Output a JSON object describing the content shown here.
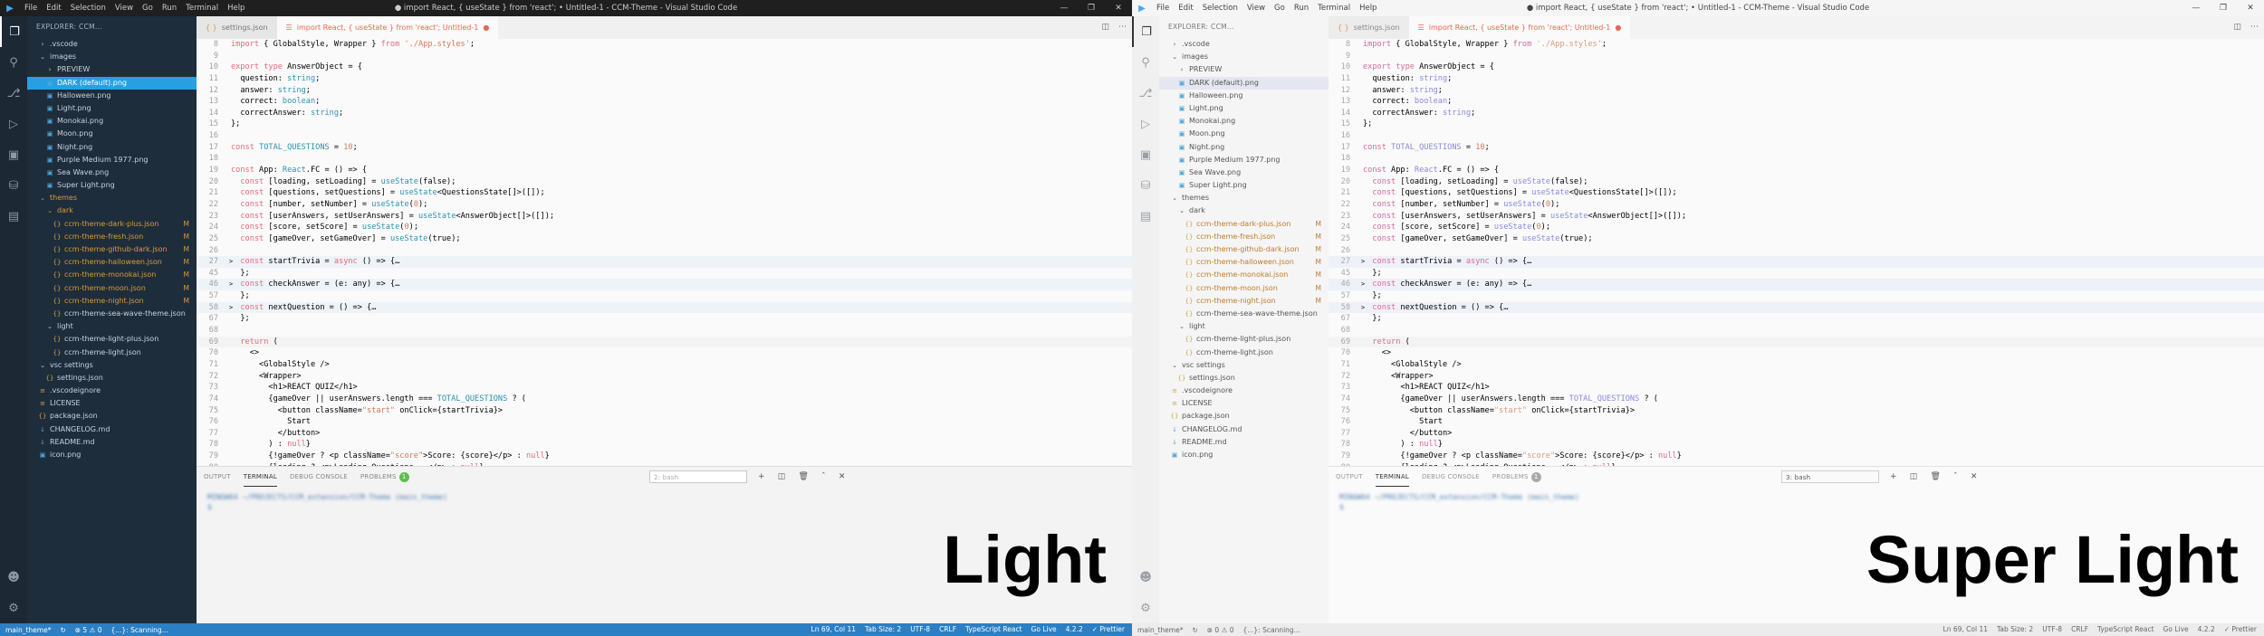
{
  "windows": [
    {
      "theme_label": "Light",
      "title": "● import React, { useState } from 'react'; • Untitled-1 - CCM-Theme - Visual Studio Code",
      "menus": [
        "File",
        "Edit",
        "Selection",
        "View",
        "Go",
        "Run",
        "Terminal",
        "Help"
      ],
      "sidebar_title": "EXPLORER: CCM...",
      "tabs": [
        {
          "label": "settings.json",
          "active": false
        },
        {
          "label": "import React, { useState } from 'react'; Untitled-1",
          "active": true
        }
      ]
    },
    {
      "theme_label": "Super Light",
      "title": "● import React, { useState } from 'react'; • Untitled-1 - CCM-Theme - Visual Studio Code",
      "menus": [
        "File",
        "Edit",
        "Selection",
        "View",
        "Go",
        "Run",
        "Terminal",
        "Help"
      ],
      "sidebar_title": "EXPLORER: CCM...",
      "tabs": [
        {
          "label": "settings.json",
          "active": false
        },
        {
          "label": "import React, { useState } from 'react'; Untitled-1",
          "active": true
        }
      ]
    }
  ],
  "tree_left": [
    {
      "label": ".vscode",
      "depth": 1,
      "kind": "folder"
    },
    {
      "label": "images",
      "depth": 1,
      "kind": "folder-open"
    },
    {
      "label": "PREVIEW",
      "depth": 2,
      "kind": "folder"
    },
    {
      "label": "DARK (default).png",
      "depth": 2,
      "kind": "png",
      "sel": true
    },
    {
      "label": "Halloween.png",
      "depth": 2,
      "kind": "png"
    },
    {
      "label": "Light.png",
      "depth": 2,
      "kind": "png"
    },
    {
      "label": "Monokai.png",
      "depth": 2,
      "kind": "png"
    },
    {
      "label": "Moon.png",
      "depth": 2,
      "kind": "png"
    },
    {
      "label": "Night.png",
      "depth": 2,
      "kind": "png"
    },
    {
      "label": "Purple Medium 1977.png",
      "depth": 2,
      "kind": "png"
    },
    {
      "label": "Sea Wave.png",
      "depth": 2,
      "kind": "png"
    },
    {
      "label": "Super Light.png",
      "depth": 2,
      "kind": "png"
    },
    {
      "label": "themes",
      "depth": 1,
      "kind": "folder-open",
      "mod": true
    },
    {
      "label": "dark",
      "depth": 2,
      "kind": "folder-open",
      "mod": true
    },
    {
      "label": "ccm-theme-dark-plus.json",
      "depth": 3,
      "kind": "json",
      "mod": true,
      "badge": "M"
    },
    {
      "label": "ccm-theme-fresh.json",
      "depth": 3,
      "kind": "json",
      "mod": true,
      "badge": "M"
    },
    {
      "label": "ccm-theme-github-dark.json",
      "depth": 3,
      "kind": "json",
      "mod": true,
      "badge": "M"
    },
    {
      "label": "ccm-theme-halloween.json",
      "depth": 3,
      "kind": "json",
      "mod": true,
      "badge": "M"
    },
    {
      "label": "ccm-theme-monokai.json",
      "depth": 3,
      "kind": "json",
      "mod": true,
      "badge": "M"
    },
    {
      "label": "ccm-theme-moon.json",
      "depth": 3,
      "kind": "json",
      "mod": true,
      "badge": "M"
    },
    {
      "label": "ccm-theme-night.json",
      "depth": 3,
      "kind": "json",
      "mod": true,
      "badge": "M"
    },
    {
      "label": "ccm-theme-sea-wave-theme.json",
      "depth": 3,
      "kind": "json"
    },
    {
      "label": "light",
      "depth": 2,
      "kind": "folder-open"
    },
    {
      "label": "ccm-theme-light-plus.json",
      "depth": 3,
      "kind": "json"
    },
    {
      "label": "ccm-theme-light.json",
      "depth": 3,
      "kind": "json"
    },
    {
      "label": "vsc settings",
      "depth": 1,
      "kind": "folder-open"
    },
    {
      "label": "settings.json",
      "depth": 2,
      "kind": "json"
    },
    {
      "label": ".vscodeignore",
      "depth": 1,
      "kind": "file"
    },
    {
      "label": "LICENSE",
      "depth": 1,
      "kind": "file"
    },
    {
      "label": "package.json",
      "depth": 1,
      "kind": "json"
    },
    {
      "label": "CHANGELOG.md",
      "depth": 1,
      "kind": "md"
    },
    {
      "label": "README.md",
      "depth": 1,
      "kind": "md"
    },
    {
      "label": "icon.png",
      "depth": 1,
      "kind": "png"
    }
  ],
  "tree_right": [
    {
      "label": ".vscode",
      "depth": 1,
      "kind": "folder"
    },
    {
      "label": "images",
      "depth": 1,
      "kind": "folder-open"
    },
    {
      "label": "PREVIEW",
      "depth": 2,
      "kind": "folder"
    },
    {
      "label": "DARK (default).png",
      "depth": 2,
      "kind": "png",
      "sel": true
    },
    {
      "label": "Halloween.png",
      "depth": 2,
      "kind": "png"
    },
    {
      "label": "Light.png",
      "depth": 2,
      "kind": "png"
    },
    {
      "label": "Monokai.png",
      "depth": 2,
      "kind": "png"
    },
    {
      "label": "Moon.png",
      "depth": 2,
      "kind": "png"
    },
    {
      "label": "Night.png",
      "depth": 2,
      "kind": "png"
    },
    {
      "label": "Purple Medium 1977.png",
      "depth": 2,
      "kind": "png"
    },
    {
      "label": "Sea Wave.png",
      "depth": 2,
      "kind": "png"
    },
    {
      "label": "Super Light.png",
      "depth": 2,
      "kind": "png"
    },
    {
      "label": "themes",
      "depth": 1,
      "kind": "folder-open"
    },
    {
      "label": "dark",
      "depth": 2,
      "kind": "folder-open"
    },
    {
      "label": "ccm-theme-dark-plus.json",
      "depth": 3,
      "kind": "json",
      "mod": true,
      "badge": "M"
    },
    {
      "label": "ccm-theme-fresh.json",
      "depth": 3,
      "kind": "json",
      "mod": true,
      "badge": "M"
    },
    {
      "label": "ccm-theme-github-dark.json",
      "depth": 3,
      "kind": "json",
      "mod": true,
      "badge": "M"
    },
    {
      "label": "ccm-theme-halloween.json",
      "depth": 3,
      "kind": "json",
      "mod": true,
      "badge": "M"
    },
    {
      "label": "ccm-theme-monokai.json",
      "depth": 3,
      "kind": "json",
      "mod": true,
      "badge": "M"
    },
    {
      "label": "ccm-theme-moon.json",
      "depth": 3,
      "kind": "json",
      "mod": true,
      "badge": "M"
    },
    {
      "label": "ccm-theme-night.json",
      "depth": 3,
      "kind": "json",
      "mod": true,
      "badge": "M"
    },
    {
      "label": "ccm-theme-sea-wave-theme.json",
      "depth": 3,
      "kind": "json"
    },
    {
      "label": "light",
      "depth": 2,
      "kind": "folder-open"
    },
    {
      "label": "ccm-theme-light-plus.json",
      "depth": 3,
      "kind": "json"
    },
    {
      "label": "ccm-theme-light.json",
      "depth": 3,
      "kind": "json"
    },
    {
      "label": "vsc settings",
      "depth": 1,
      "kind": "folder-open"
    },
    {
      "label": "settings.json",
      "depth": 2,
      "kind": "json"
    },
    {
      "label": ".vscodeignore",
      "depth": 1,
      "kind": "file"
    },
    {
      "label": "LICENSE",
      "depth": 1,
      "kind": "file"
    },
    {
      "label": "package.json",
      "depth": 1,
      "kind": "json"
    },
    {
      "label": "CHANGELOG.md",
      "depth": 1,
      "kind": "md"
    },
    {
      "label": "README.md",
      "depth": 1,
      "kind": "md"
    },
    {
      "label": "icon.png",
      "depth": 1,
      "kind": "png"
    }
  ],
  "code_lines": [
    {
      "n": "8",
      "fold": "",
      "text": "import { GlobalStyle, Wrapper } from './App.styles';",
      "cls": ""
    },
    {
      "n": "9",
      "fold": "",
      "text": "",
      "cls": ""
    },
    {
      "n": "10",
      "fold": "",
      "text": "export type AnswerObject = {",
      "cls": ""
    },
    {
      "n": "11",
      "fold": "",
      "text": "  question: string;",
      "cls": ""
    },
    {
      "n": "12",
      "fold": "",
      "text": "  answer: string;",
      "cls": ""
    },
    {
      "n": "13",
      "fold": "",
      "text": "  correct: boolean;",
      "cls": ""
    },
    {
      "n": "14",
      "fold": "",
      "text": "  correctAnswer: string;",
      "cls": ""
    },
    {
      "n": "15",
      "fold": "",
      "text": "};",
      "cls": ""
    },
    {
      "n": "16",
      "fold": "",
      "text": "",
      "cls": ""
    },
    {
      "n": "17",
      "fold": "",
      "text": "const TOTAL_QUESTIONS = 10;",
      "cls": ""
    },
    {
      "n": "18",
      "fold": "",
      "text": "",
      "cls": ""
    },
    {
      "n": "19",
      "fold": "",
      "text": "const App: React.FC = () => {",
      "cls": ""
    },
    {
      "n": "20",
      "fold": "",
      "text": "  const [loading, setLoading] = useState(false);",
      "cls": ""
    },
    {
      "n": "21",
      "fold": "",
      "text": "  const [questions, setQuestions] = useState<QuestionsState[]>([]);",
      "cls": ""
    },
    {
      "n": "22",
      "fold": "",
      "text": "  const [number, setNumber] = useState(0);",
      "cls": ""
    },
    {
      "n": "23",
      "fold": "",
      "text": "  const [userAnswers, setUserAnswers] = useState<AnswerObject[]>([]);",
      "cls": ""
    },
    {
      "n": "24",
      "fold": "",
      "text": "  const [score, setScore] = useState(0);",
      "cls": ""
    },
    {
      "n": "25",
      "fold": "",
      "text": "  const [gameOver, setGameOver] = useState(true);",
      "cls": ""
    },
    {
      "n": "26",
      "fold": "",
      "text": "",
      "cls": ""
    },
    {
      "n": "27",
      "fold": ">",
      "text": "  const startTrivia = async () => {…",
      "cls": "hl"
    },
    {
      "n": "45",
      "fold": "",
      "text": "  };",
      "cls": ""
    },
    {
      "n": "46",
      "fold": ">",
      "text": "  const checkAnswer = (e: any) => {…",
      "cls": "hl"
    },
    {
      "n": "57",
      "fold": "",
      "text": "  };",
      "cls": ""
    },
    {
      "n": "58",
      "fold": ">",
      "text": "  const nextQuestion = () => {…",
      "cls": "hl"
    },
    {
      "n": "67",
      "fold": "",
      "text": "  };",
      "cls": ""
    },
    {
      "n": "68",
      "fold": "",
      "text": "",
      "cls": ""
    },
    {
      "n": "69",
      "fold": "",
      "text": "  return (",
      "cls": "cur"
    },
    {
      "n": "70",
      "fold": "",
      "text": "    <>",
      "cls": ""
    },
    {
      "n": "71",
      "fold": "",
      "text": "      <GlobalStyle />",
      "cls": ""
    },
    {
      "n": "72",
      "fold": "",
      "text": "      <Wrapper>",
      "cls": ""
    },
    {
      "n": "73",
      "fold": "",
      "text": "        <h1>REACT QUIZ</h1>",
      "cls": ""
    },
    {
      "n": "74",
      "fold": "",
      "text": "        {gameOver || userAnswers.length === TOTAL_QUESTIONS ? (",
      "cls": ""
    },
    {
      "n": "75",
      "fold": "",
      "text": "          <button className=\"start\" onClick={startTrivia}>",
      "cls": ""
    },
    {
      "n": "76",
      "fold": "",
      "text": "            Start",
      "cls": ""
    },
    {
      "n": "77",
      "fold": "",
      "text": "          </button>",
      "cls": ""
    },
    {
      "n": "78",
      "fold": "",
      "text": "        ) : null}",
      "cls": ""
    },
    {
      "n": "79",
      "fold": "",
      "text": "        {!gameOver ? <p className=\"score\">Score: {score}</p> : null}",
      "cls": ""
    },
    {
      "n": "80",
      "fold": "",
      "text": "        {loading ? <p>Loading Questions...</p> : null}",
      "cls": ""
    }
  ],
  "panel": {
    "tabs": [
      "OUTPUT",
      "TERMINAL",
      "DEBUG CONSOLE",
      "PROBLEMS"
    ],
    "active_tab": "TERMINAL",
    "problems_count_left": "1",
    "problems_count_right": "1",
    "select_left": "2: bash",
    "select_right": "3: bash",
    "terminal_line": "MINGW64 ~/PROJECTS/CCM_extension/CCM-Theme (main_theme)",
    "terminal_prompt": "$"
  },
  "status_left": {
    "branch": "main_theme*",
    "sync": "↻",
    "problems": "⊗ 5 ⚠ 0",
    "scanning": "{...}: Scanning...",
    "position": "Ln 69, Col 11",
    "tab_size": "Tab Size: 2",
    "encoding": "UTF-8",
    "eol": "CRLF",
    "language": "TypeScript React",
    "golive": "Go Live",
    "version": "4.2.2",
    "prettier": "✓ Prettier"
  },
  "status_right": {
    "branch": "main_theme*",
    "sync": "↻",
    "problems": "⊗ 0 ⚠ 0",
    "scanning": "{...}: Scanning...",
    "position": "Ln 69, Col 11",
    "tab_size": "Tab Size: 2",
    "encoding": "UTF-8",
    "eol": "CRLF",
    "language": "TypeScript React",
    "golive": "Go Live",
    "version": "4.2.2",
    "prettier": "✓ Prettier"
  },
  "colors": {
    "light_sidebar": "#1e2d3c",
    "light_statusbar": "#2b7fc4",
    "selected_file": "#27a0e2",
    "active_tab_text": "#e4694f",
    "modified": "#d89a3a"
  },
  "icons": [
    "files-icon",
    "search-icon",
    "source-control-icon",
    "run-icon",
    "extensions-icon",
    "database-icon",
    "remote-icon",
    "account-icon",
    "gear-icon"
  ]
}
